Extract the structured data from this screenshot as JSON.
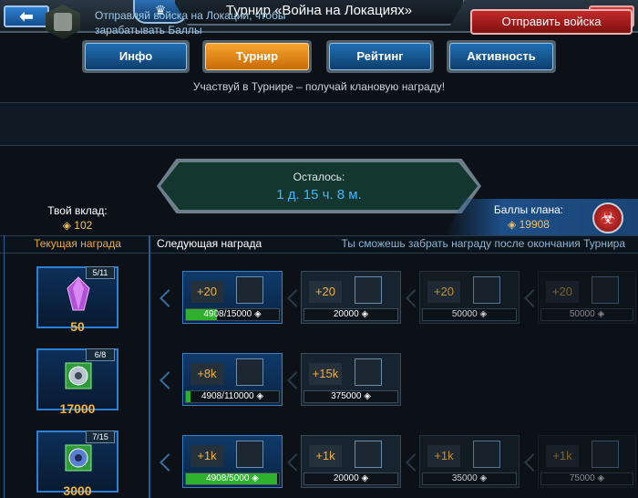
{
  "header": {
    "title": "Турнир «Война на Локациях»",
    "back_icon": "arrow-left-icon",
    "close_icon": "close-icon",
    "back_glyph": "⬅",
    "close_glyph": "✖",
    "clan_glyph": "♛"
  },
  "tabs": [
    {
      "label": "Инфо",
      "active": false
    },
    {
      "label": "Турнир",
      "active": true
    },
    {
      "label": "Рейтинг",
      "active": false
    },
    {
      "label": "Активность",
      "active": false
    }
  ],
  "subtitle": "Участвуй в Турнире – получай клановую награду!",
  "send": {
    "text_line1": "Отправляй войска на Локации, чтобы",
    "text_line2": "зарабатывать Баллы",
    "button_label": "Отправить войска"
  },
  "timer": {
    "label": "Осталось:",
    "value": "1 д. 15 ч. 8 м."
  },
  "contribution": {
    "label": "Твой вклад:",
    "value": "◈ 102"
  },
  "clan_points": {
    "label": "Баллы клана:",
    "value": "◈ 19908",
    "icon": "biohazard-icon",
    "glyph": "☣"
  },
  "table": {
    "current_header": "Текущая награда",
    "next_header": "Следующая награда",
    "note": "Ты сможешь забрать награду после окончания Турнира"
  },
  "rows": [
    {
      "current": {
        "count": "5/11",
        "value": "50",
        "icon": "crystal-icon"
      },
      "cards": [
        {
          "amount": "+20",
          "bar": "4908/15000 ◈",
          "progress": 0.33
        },
        {
          "amount": "+20",
          "bar": "20000 ◈"
        },
        {
          "amount": "+20",
          "bar": "50000 ◈"
        },
        {
          "amount": "+20",
          "bar": "50000 ◈"
        }
      ]
    },
    {
      "current": {
        "count": "6/8",
        "value": "17000",
        "icon": "gear-icon"
      },
      "cards": [
        {
          "amount": "+8k",
          "bar": "4908/110000 ◈",
          "progress": 0.045
        },
        {
          "amount": "+15k",
          "bar": "375000 ◈"
        }
      ]
    },
    {
      "current": {
        "count": "7/15",
        "value": "3000",
        "icon": "gear-icon"
      },
      "cards": [
        {
          "amount": "+1k",
          "bar": "4908/5000 ◈",
          "progress": 0.98
        },
        {
          "amount": "+1k",
          "bar": "20000 ◈"
        },
        {
          "amount": "+1k",
          "bar": "35000 ◈"
        },
        {
          "amount": "+1k",
          "bar": "75000 ◈"
        }
      ]
    }
  ],
  "colors": {
    "accent_blue": "#2b7fd4",
    "active_tab": "#f7a52e",
    "send_button": "#c62a2a",
    "gold": "#f5b53a",
    "progress": "#2fb12f"
  }
}
